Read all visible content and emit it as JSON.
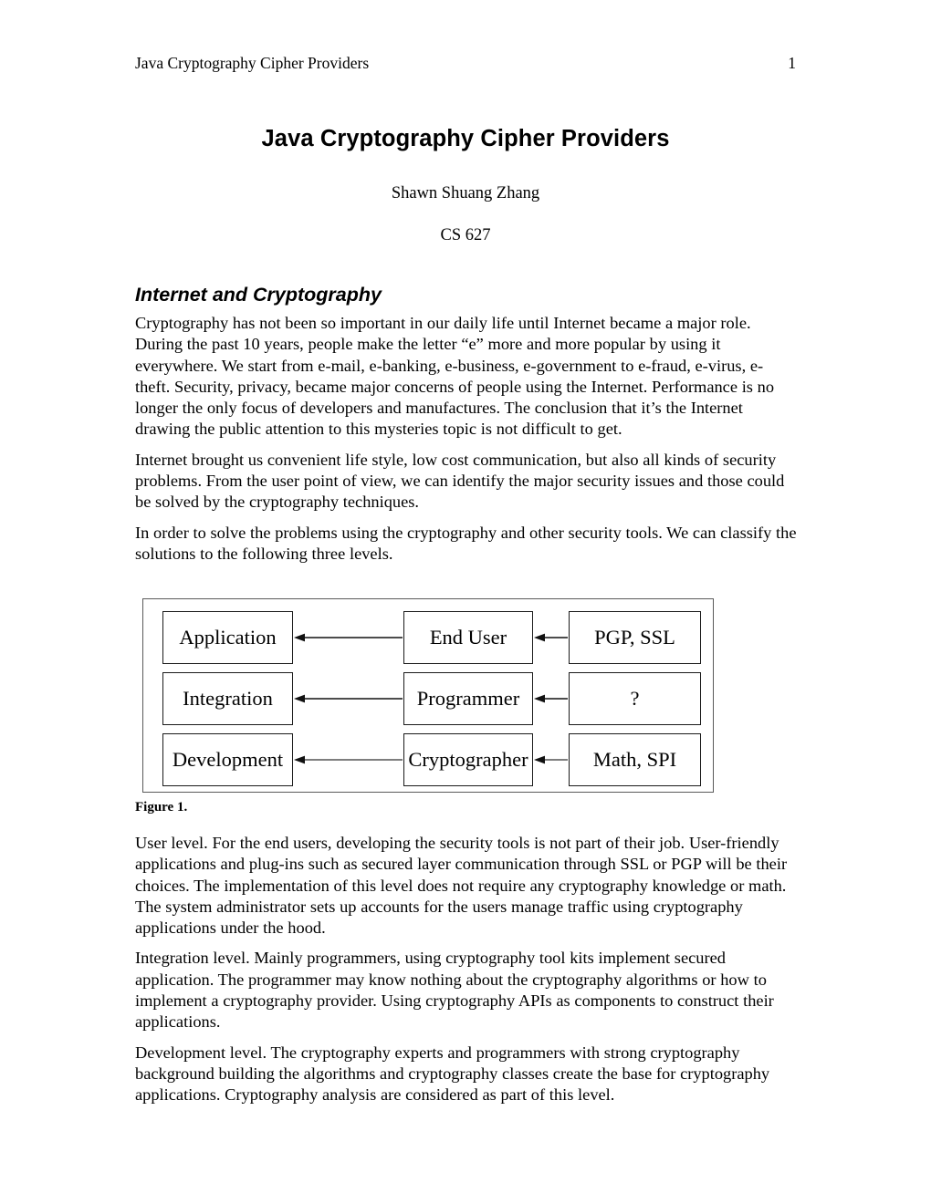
{
  "header": {
    "title": "Java Cryptography Cipher Providers",
    "page_number": "1"
  },
  "title_block": {
    "title": "Java Cryptography Cipher Providers",
    "author": "Shawn Shuang Zhang",
    "course": "CS 627"
  },
  "section": {
    "heading": "Internet and Cryptography"
  },
  "paragraphs_before_figure": [
    "Cryptography has not been so important in our daily life until Internet became a major role. During the past 10 years, people make the letter “e” more and more popular by using it everywhere. We start from e-mail, e-banking, e-business, e-government to e-fraud, e-virus, e-theft. Security, privacy, became major concerns of people using the Internet. Performance is no longer the only focus of developers and manufactures. The conclusion that it’s the Internet drawing the public attention to this mysteries topic is not difficult to get.",
    "Internet brought us convenient life style, low cost communication, but also all kinds of security problems. From the user point of view, we can identify the major security issues and those could be solved by the cryptography techniques.",
    "In order to solve the problems using the cryptography and other security tools. We can classify the solutions to the following three levels."
  ],
  "figure": {
    "caption": "Figure 1.",
    "rows": [
      {
        "level": "Application",
        "actor": "End User",
        "tools": "PGP, SSL"
      },
      {
        "level": "Integration",
        "actor": "Programmer",
        "tools": "?"
      },
      {
        "level": "Development",
        "actor": "Cryptographer",
        "tools": "Math, SPI"
      }
    ],
    "arrow_direction": "left",
    "border_color": "#1a1a1a",
    "frame_color": "#5a5a5a"
  },
  "paragraphs_after_figure": [
    "User level. For the end users, developing the security tools is not part of their job. User-friendly applications and plug-ins such as secured layer communication through SSL or PGP will be their choices. The implementation of this level does not require any cryptography knowledge or math. The system administrator sets up accounts for the users manage traffic using cryptography applications under the hood.",
    "Integration level. Mainly programmers, using cryptography tool kits implement secured application. The programmer may know nothing about the cryptography algorithms or how to implement a cryptography provider. Using cryptography APIs as components to construct their applications.",
    "Development level. The cryptography experts and programmers with strong cryptography background building the algorithms and cryptography classes create the base for cryptography applications. Cryptography analysis are considered as part of this level."
  ]
}
